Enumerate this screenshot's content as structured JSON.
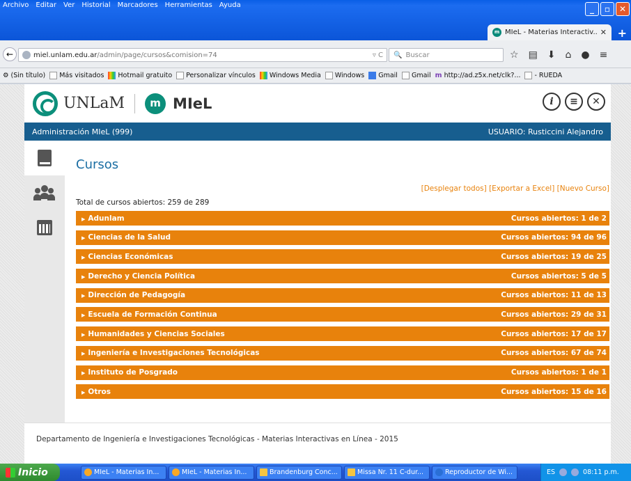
{
  "browser": {
    "menu": [
      "Archivo",
      "Editar",
      "Ver",
      "Historial",
      "Marcadores",
      "Herramientas",
      "Ayuda"
    ],
    "tab_title": "MIeL - Materias Interactiv...",
    "tab_favicon": "m",
    "url_host": "miel.unlam.edu.ar",
    "url_path": "/admin/page/cursos&comision=74",
    "search_placeholder": "Buscar",
    "bookmarks": [
      "(Sin título)",
      "Más visitados",
      "Hotmail gratuito",
      "Personalizar vínculos",
      "Windows Media",
      "Windows",
      "Gmail",
      "Gmail",
      "http://ad.z5x.net/clk?...",
      "- RUEDA"
    ]
  },
  "header": {
    "unlam": "UNLaM",
    "miel_badge": "m",
    "miel": "MIeL",
    "admin_label": "Administración MIeL  (999)",
    "user_label": "USUARIO: Rusticcini Alejandro"
  },
  "main": {
    "title": "Cursos",
    "actions": [
      "[Desplegar todos]",
      "[Exportar a Excel]",
      "[Nuevo Curso]"
    ],
    "total": "Total de cursos abiertos: 259 de 289",
    "rows": [
      {
        "name": "Adunlam",
        "count": "Cursos abiertos: 1 de 2"
      },
      {
        "name": "Ciencias de la Salud",
        "count": "Cursos abiertos: 94 de 96"
      },
      {
        "name": "Ciencias Económicas",
        "count": "Cursos abiertos: 19 de 25"
      },
      {
        "name": "Derecho y Ciencia Política",
        "count": "Cursos abiertos: 5 de 5"
      },
      {
        "name": "Dirección de Pedagogía",
        "count": "Cursos abiertos: 11 de 13"
      },
      {
        "name": "Escuela de Formación Continua",
        "count": "Cursos abiertos: 29 de 31"
      },
      {
        "name": "Humanidades y Ciencias Sociales",
        "count": "Cursos abiertos: 17 de 17"
      },
      {
        "name": "Ingeniería e Investigaciones Tecnológicas",
        "count": "Cursos abiertos: 67 de 74"
      },
      {
        "name": "Instituto de Posgrado",
        "count": "Cursos abiertos: 1 de 1"
      },
      {
        "name": "Otros",
        "count": "Cursos abiertos: 15 de 16"
      }
    ]
  },
  "footer": {
    "text": "Departamento de Ingeniería e Investigaciones Tecnológicas - Materias Interactivas en Línea - 2015"
  },
  "taskbar": {
    "start": "Inicio",
    "tasks": [
      "MIeL - Materias In...",
      "MIeL - Materias In...",
      "Brandenburg Conc...",
      "Missa Nr. 11 C-dur...",
      "Reproductor de Wi..."
    ],
    "lang": "ES",
    "clock": "08:11 p.m."
  },
  "colors": {
    "accent_orange": "#e8820c",
    "header_blue": "#175e8f",
    "brand_green": "#0c8f7b",
    "title_blue": "#1b6ea3"
  },
  "icons": {
    "sidebar": [
      "book-icon",
      "users-icon",
      "calendar-icon"
    ],
    "header": [
      "info-icon",
      "menu-icon",
      "close-icon"
    ]
  }
}
